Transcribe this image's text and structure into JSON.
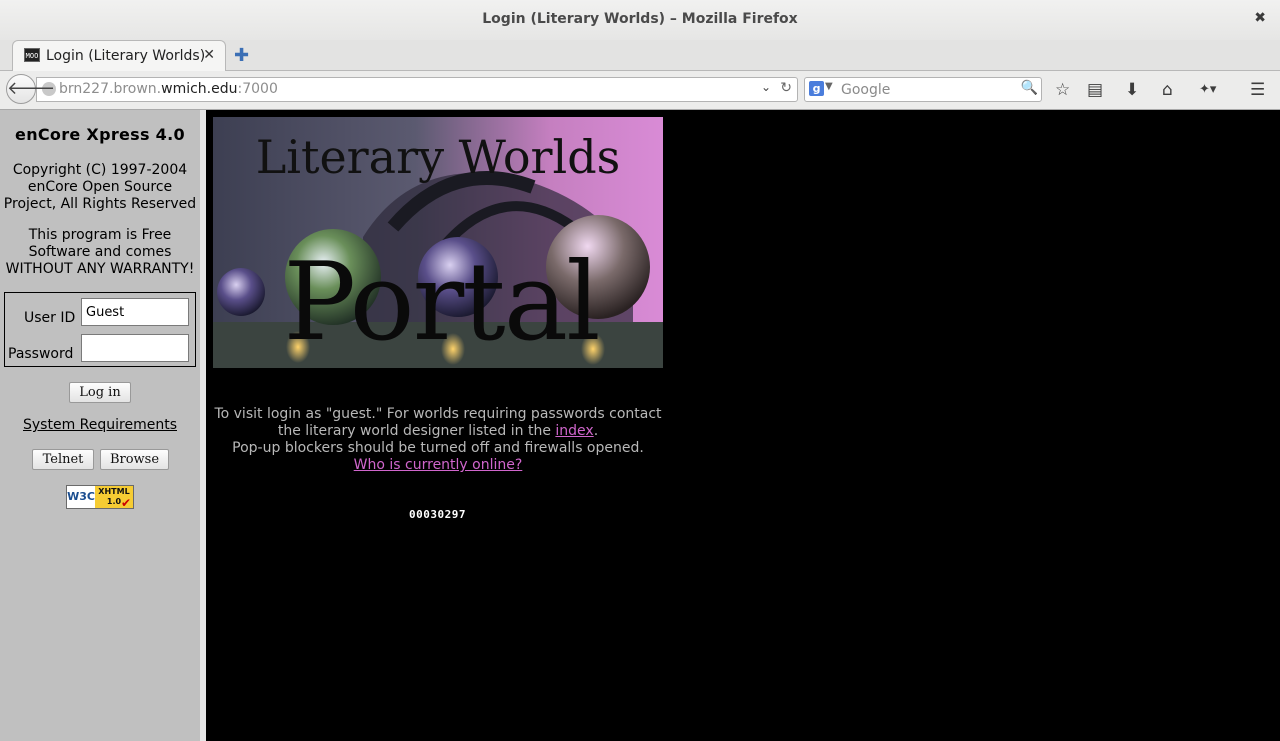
{
  "window": {
    "title": "Login (Literary Worlds) – Mozilla Firefox"
  },
  "tabs": [
    {
      "label": "Login (Literary Worlds)",
      "favicon_text": "MOO"
    }
  ],
  "nav": {
    "url_prefix": "brn227.brown.",
    "url_host": "wmich.edu",
    "url_suffix": ":7000",
    "search_placeholder": "Google"
  },
  "sidebar": {
    "title": "enCore Xpress 4.0",
    "copyright": [
      "Copyright (C) 1997-2004",
      "enCore Open Source",
      "Project, All Rights Reserved"
    ],
    "license": [
      "This program is Free",
      "Software and comes",
      "WITHOUT ANY WARRANTY!"
    ],
    "userid_label": "User ID",
    "userid_value": "Guest",
    "password_label": "Password",
    "login_button": "Log in",
    "sysreq_link": "System Requirements",
    "telnet_button": "Telnet",
    "browse_button": "Browse",
    "badge": {
      "left": "W3C",
      "top": "XHTML",
      "bottom": "1.0"
    }
  },
  "main": {
    "banner": {
      "title": "Literary Worlds",
      "word": "Portal"
    },
    "message": {
      "line1": "To visit login as \"guest.\" For worlds requiring passwords contact",
      "line2_pre": "the literary world designer listed in the ",
      "index_link": "index",
      "line2_post": ".",
      "line3": "Pop-up blockers should be turned off and firewalls opened.",
      "online_link": "Who is currently online?"
    },
    "counter": "00030297"
  },
  "colors": {
    "page_bg": "#000000",
    "sidebar_bg": "#c0c0c0",
    "link": "#d066cc",
    "message_text": "#b8b8b8"
  }
}
